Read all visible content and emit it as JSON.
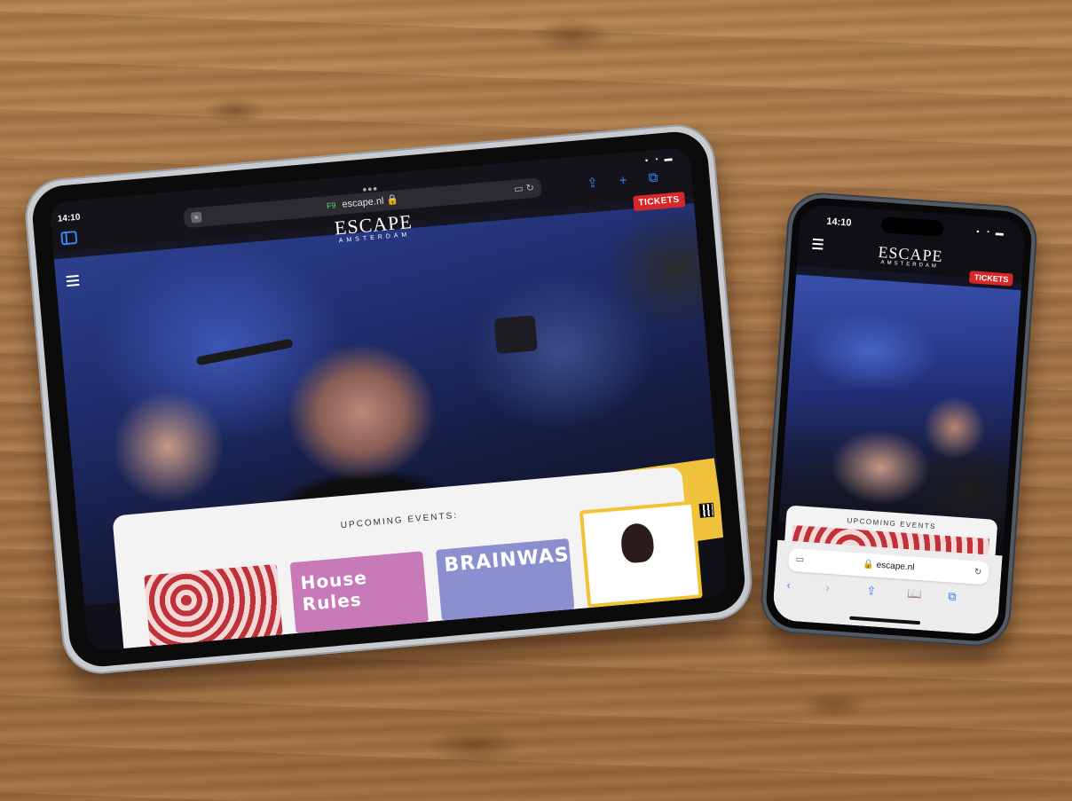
{
  "tablet": {
    "status_time": "14:10",
    "status_icons": "▪ ◔ ▬",
    "dots": "•••",
    "url_close": "×",
    "url_badge": "F9",
    "url": "escape.nl 🔒",
    "url_right": "▭ ↻",
    "actions": "⇪ + ⧉",
    "logo_main": "ESCAPE",
    "logo_sub": "AMSTERDAM",
    "tickets": "TICKETS",
    "events_title": "UPCOMING EVENTS:",
    "card_house_rules": "House Rules",
    "card_brainwash": "BRAINWASH"
  },
  "phone": {
    "status_time": "14:10",
    "status_icons": "▪ ◔ ▬",
    "logo_main": "ESCAPE",
    "logo_sub": "AMSTERDAM",
    "tickets": "TICKETS",
    "events_title": "UPCOMING EVENTS",
    "url": "🔒 escape.nl",
    "url_left": "▭",
    "url_right": "↻",
    "toolbar": {
      "back": "‹",
      "forward": "›",
      "share": "⇪",
      "bookmarks": "📖",
      "tabs": "⧉"
    }
  },
  "colors": {
    "accent_blue": "#3b82f6",
    "tickets_red": "#d62828",
    "wood": "#a9794a"
  }
}
